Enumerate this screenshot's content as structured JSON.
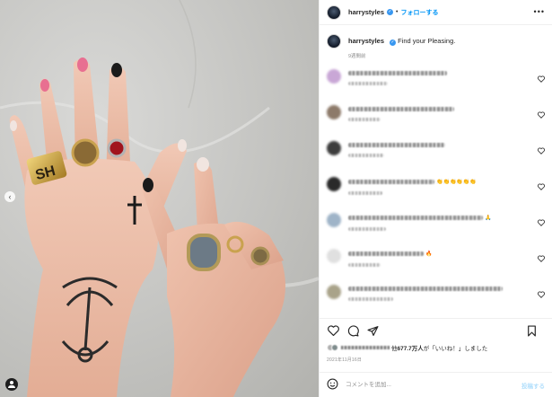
{
  "media": {
    "carousel_prev_glyph": "‹",
    "alt_icon": "user-tag-icon"
  },
  "header": {
    "username": "harrystyles",
    "separator": "•",
    "follow_label": "フォローする",
    "more_glyph": "•••"
  },
  "caption": {
    "username": "harrystyles",
    "text": "Find your Pleasing.",
    "time": "9週間前"
  },
  "comments": [
    {
      "avatar_color": "#c9a7d6",
      "emojis": ""
    },
    {
      "avatar_color": "#8d7a6a",
      "emojis": ""
    },
    {
      "avatar_color": "#3d3d3d",
      "emojis": ""
    },
    {
      "avatar_color": "#2a2a2a",
      "emojis": "👏👏👏👏👏👏"
    },
    {
      "avatar_color": "#9fb4c8",
      "emojis": "🙏"
    },
    {
      "avatar_color": "#e0e0e0",
      "emojis": "🔥"
    },
    {
      "avatar_color": "#a9a38a",
      "emojis": ""
    }
  ],
  "footer": {
    "likes_prefix": "他",
    "likes_count": "677.7万人",
    "likes_suffix": "が「いいね！」しました",
    "date": "2021年11月16日",
    "comment_placeholder": "コメントを追加...",
    "post_label": "投稿する"
  },
  "colors": {
    "accent": "#0095f6",
    "verified": "#3897f0",
    "post_disabled": "#b2dffc"
  }
}
